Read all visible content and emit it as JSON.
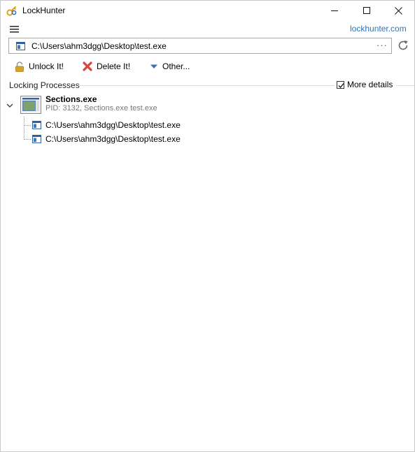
{
  "window": {
    "title": "LockHunter"
  },
  "header": {
    "site_link": "lockhunter.com"
  },
  "path_bar": {
    "value": "C:\\Users\\ahm3dgg\\Desktop\\test.exe",
    "more_label": "···"
  },
  "toolbar": {
    "unlock_label": "Unlock It!",
    "delete_label": "Delete It!",
    "other_label": "Other..."
  },
  "locking_group": {
    "title": "Locking Processes",
    "more_details_label": "More details",
    "more_details_checked": true
  },
  "processes": [
    {
      "name": "Sections.exe",
      "detail": "PID: 3132, Sections.exe  test.exe",
      "files": [
        "C:\\Users\\ahm3dgg\\Desktop\\test.exe",
        "C:\\Users\\ahm3dgg\\Desktop\\test.exe"
      ]
    }
  ],
  "colors": {
    "link": "#2f74b5",
    "delete_red": "#d9443a",
    "lock_gold": "#d7a227",
    "dropdown_blue": "#3b6fb6"
  },
  "icons": [
    "lockhunter-icon",
    "minimize-icon",
    "maximize-icon",
    "close-icon",
    "menu-icon",
    "file-icon",
    "refresh-icon",
    "lock-icon",
    "delete-x-icon",
    "dropdown-triangle-icon",
    "checkbox-check-icon",
    "chevron-down-icon",
    "process-window-icon"
  ]
}
